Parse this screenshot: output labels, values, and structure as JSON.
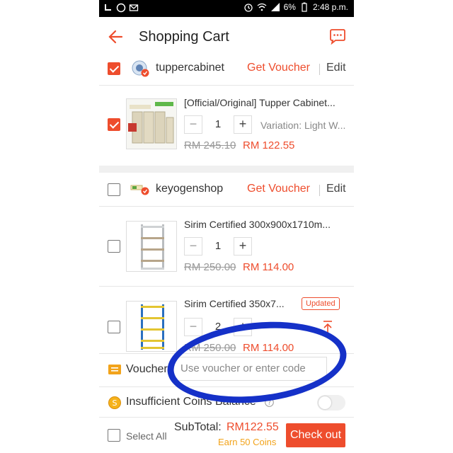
{
  "status_bar": {
    "battery": "6%",
    "time": "2:48 p.m."
  },
  "header": {
    "title": "Shopping Cart"
  },
  "shops": [
    {
      "name": "tuppercabinet",
      "voucher_label": "Get Voucher",
      "edit_label": "Edit",
      "checked": true,
      "items": [
        {
          "name": "[Official/Original] Tupper Cabinet...",
          "quantity": "1",
          "variation": "Variation: Light W...",
          "old_price": "RM 245.10",
          "new_price": "RM 122.55",
          "checked": true
        }
      ]
    },
    {
      "name": "keyogenshop",
      "voucher_label": "Get Voucher",
      "edit_label": "Edit",
      "checked": false,
      "items": [
        {
          "name": "Sirim Certified 300x900x1710m...",
          "quantity": "1",
          "old_price": "RM 250.00",
          "new_price": "RM 114.00",
          "checked": false
        },
        {
          "name": "Sirim Certified 350x7...",
          "badge": "Updated",
          "quantity": "2",
          "old_price": "RM 250.00",
          "new_price": "RM 114.00",
          "checked": false
        }
      ]
    }
  ],
  "voucher": {
    "label": "Voucher",
    "placeholder": "Use voucher or enter code"
  },
  "coins": {
    "label": "Insufficient Coins Balance"
  },
  "footer": {
    "select_all": "Select All",
    "subtotal_label": "SubTotal:",
    "subtotal_value": "RM122.55",
    "earn_coins": "Earn 50 Coins",
    "checkout_label": "Check out"
  },
  "colors": {
    "accent": "#ee4d2d",
    "annotation": "#1531c8"
  }
}
